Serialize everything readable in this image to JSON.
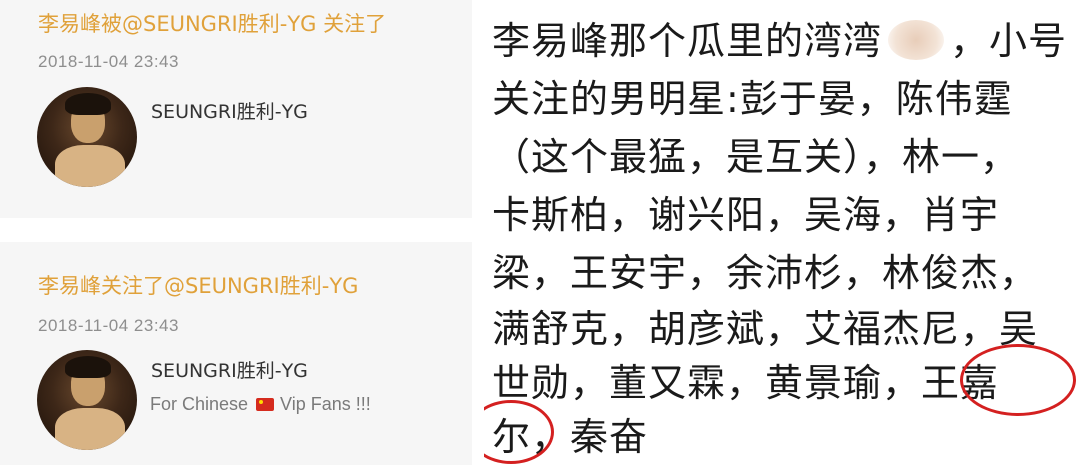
{
  "left_panel": {
    "cards": [
      {
        "headline": "李易峰被@SEUNGRI胜利-YG 关注了",
        "timestamp": "2018-11-04 23:43",
        "username": "SEUNGRI胜利-YG",
        "bio": ""
      },
      {
        "headline": "李易峰关注了@SEUNGRI胜利-YG",
        "timestamp": "2018-11-04 23:43",
        "username": "SEUNGRI胜利-YG",
        "bio_prefix": "For Chinese",
        "bio_suffix": "Vip Fans !!!"
      }
    ]
  },
  "right_panel": {
    "lines": [
      {
        "a": "李易峰那个瓜里的湾湾",
        "b": "，小号"
      },
      {
        "a": "关注的男明星:彭于晏，陈伟霆"
      },
      {
        "a": "（这个最猛，是互关），林一，"
      },
      {
        "a": "卡斯柏，谢兴阳，吴海，肖宇"
      },
      {
        "a": "梁，王安宇，余沛杉，林俊杰，"
      },
      {
        "a": "满舒克，胡彦斌，艾福杰尼，吴"
      },
      {
        "a": "世勋，董又霖，黄景瑜，王嘉"
      },
      {
        "a": "尔，秦奋"
      }
    ]
  },
  "colors": {
    "headline": "#e0a13a",
    "annotation_circle": "#d42020",
    "card_background": "#f6f6f6"
  }
}
